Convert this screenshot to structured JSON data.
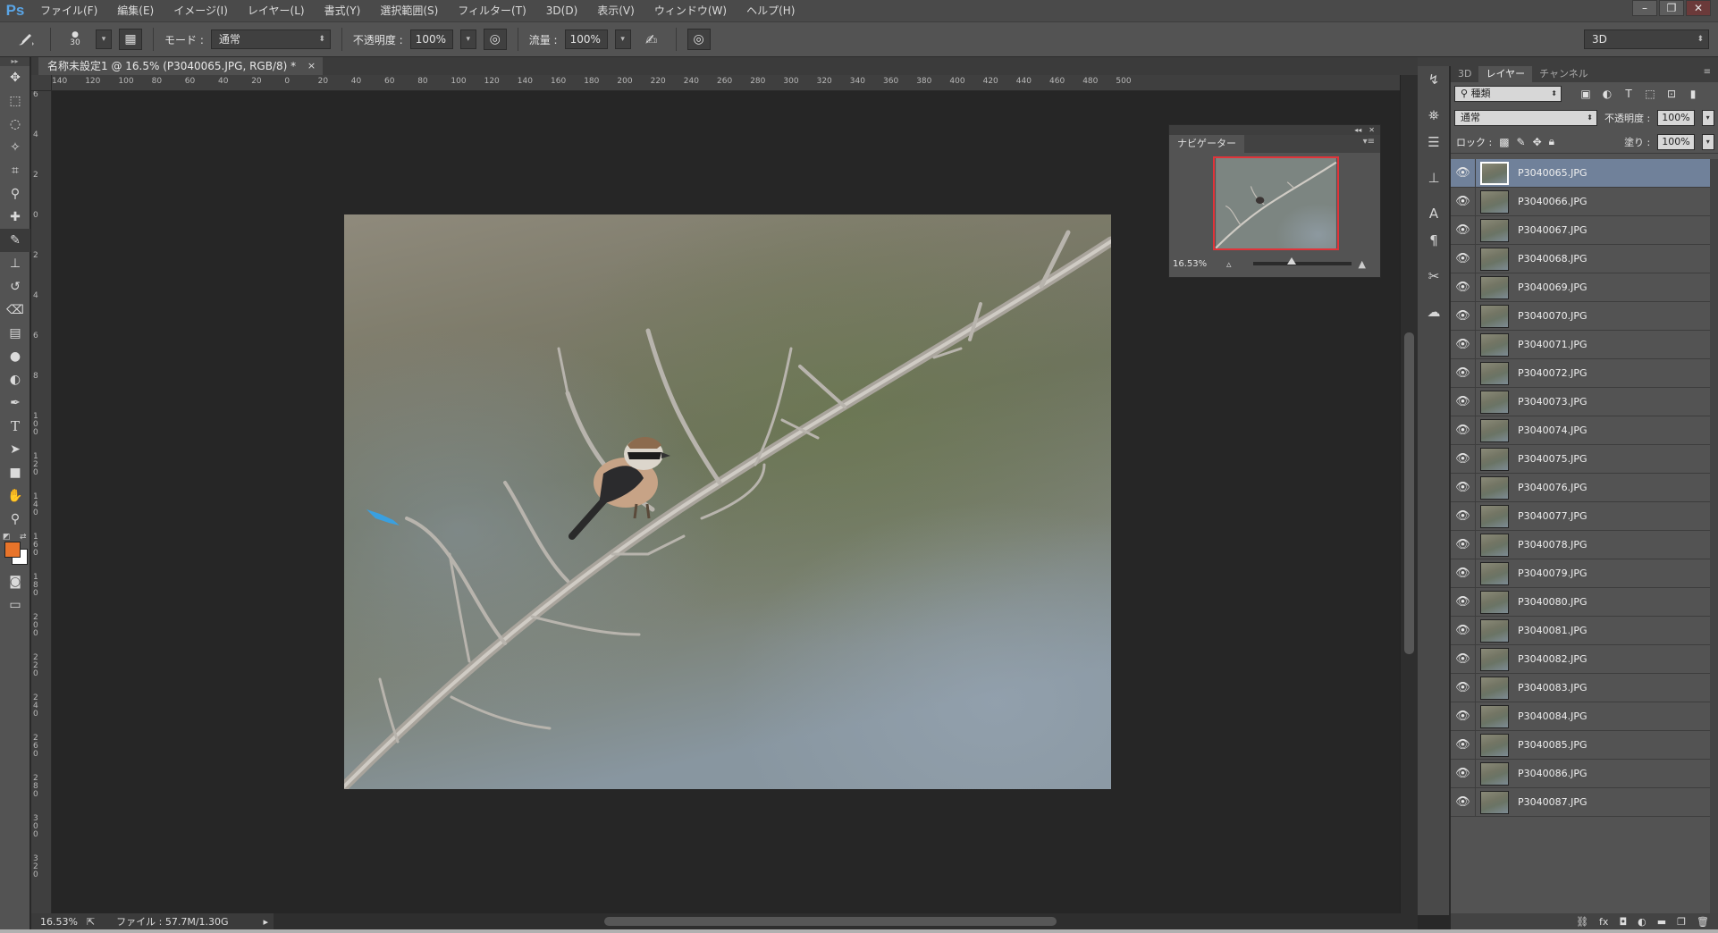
{
  "app": {
    "logo": "Ps"
  },
  "menubar": {
    "items": [
      "ファイル(F)",
      "編集(E)",
      "イメージ(I)",
      "レイヤー(L)",
      "書式(Y)",
      "選択範囲(S)",
      "フィルター(T)",
      "3D(D)",
      "表示(V)",
      "ウィンドウ(W)",
      "ヘルプ(H)"
    ]
  },
  "window_controls": {
    "minimize": "–",
    "restore": "❐",
    "close": "✕"
  },
  "options": {
    "brush_size": "30",
    "mode_label": "モード :",
    "mode_value": "通常",
    "opacity_label": "不透明度 :",
    "opacity_value": "100%",
    "flow_label": "流量 :",
    "flow_value": "100%",
    "workspace": "3D"
  },
  "tools": {
    "icons": [
      "move-tool-icon",
      "marquee-tool-icon",
      "lasso-tool-icon",
      "magic-wand-tool-icon",
      "crop-tool-icon",
      "eyedropper-tool-icon",
      "healing-brush-tool-icon",
      "brush-tool-icon",
      "clone-stamp-tool-icon",
      "history-brush-tool-icon",
      "eraser-tool-icon",
      "gradient-tool-icon",
      "blur-tool-icon",
      "dodge-tool-icon",
      "pen-tool-icon",
      "type-tool-icon",
      "path-selection-tool-icon",
      "rectangle-tool-icon",
      "hand-tool-icon",
      "zoom-tool-icon"
    ],
    "foreground_color": "#e8742a",
    "background_color": "#ffffff"
  },
  "document": {
    "tab_title": "名称未設定1 @ 16.5% (P3040065.JPG, RGB/8) *",
    "close": "×",
    "ruler_h": [
      "140",
      "120",
      "100",
      "80",
      "60",
      "40",
      "20",
      "0",
      "20",
      "40",
      "60",
      "80",
      "100",
      "120",
      "140",
      "160",
      "180",
      "200",
      "220",
      "240",
      "260",
      "280",
      "300",
      "320",
      "340",
      "360",
      "380",
      "400",
      "420",
      "440",
      "460",
      "480",
      "500"
    ],
    "ruler_v": [
      "6",
      "4",
      "2",
      "0",
      "2",
      "4",
      "6",
      "8",
      "100",
      "120",
      "140",
      "160",
      "180",
      "200",
      "220",
      "240",
      "260",
      "280",
      "300",
      "320"
    ]
  },
  "status": {
    "zoom": "16.53%",
    "file_info": "ファイル : 57.7M/1.30G"
  },
  "navigator": {
    "title": "ナビゲーター",
    "zoom": "16.53%"
  },
  "layers_panel": {
    "tabs": [
      "3D",
      "レイヤー",
      "チャンネル"
    ],
    "active_tab": "レイヤー",
    "filter_kind": "種類",
    "blend_mode": "通常",
    "opacity_label": "不透明度 :",
    "opacity_value": "100%",
    "lock_label": "ロック :",
    "fill_label": "塗り :",
    "fill_value": "100%",
    "layers": [
      {
        "name": "P3040065.JPG",
        "selected": true
      },
      {
        "name": "P3040066.JPG"
      },
      {
        "name": "P3040067.JPG"
      },
      {
        "name": "P3040068.JPG"
      },
      {
        "name": "P3040069.JPG"
      },
      {
        "name": "P3040070.JPG"
      },
      {
        "name": "P3040071.JPG"
      },
      {
        "name": "P3040072.JPG"
      },
      {
        "name": "P3040073.JPG"
      },
      {
        "name": "P3040074.JPG"
      },
      {
        "name": "P3040075.JPG"
      },
      {
        "name": "P3040076.JPG"
      },
      {
        "name": "P3040077.JPG"
      },
      {
        "name": "P3040078.JPG"
      },
      {
        "name": "P3040079.JPG"
      },
      {
        "name": "P3040080.JPG"
      },
      {
        "name": "P3040081.JPG"
      },
      {
        "name": "P3040082.JPG"
      },
      {
        "name": "P3040083.JPG"
      },
      {
        "name": "P3040084.JPG"
      },
      {
        "name": "P3040085.JPG"
      },
      {
        "name": "P3040086.JPG"
      },
      {
        "name": "P3040087.JPG"
      }
    ]
  }
}
